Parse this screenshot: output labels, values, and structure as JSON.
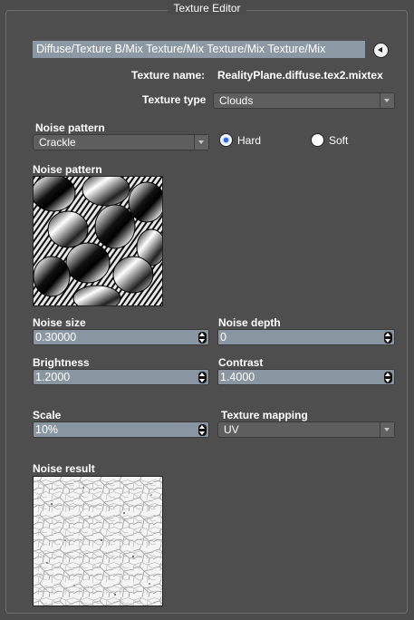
{
  "window": {
    "title": "Texture Editor"
  },
  "path": {
    "value": "Diffuse/Texture B/Mix Texture/Mix Texture/Mix Texture/Mix"
  },
  "texture": {
    "name_label": "Texture name:",
    "name_value": "RealityPlane.diffuse.tex2.mixtex",
    "type_label": "Texture type",
    "type_value": "Clouds"
  },
  "noise_pattern": {
    "label": "Noise pattern",
    "value": "Crackle",
    "preview_label": "Noise pattern"
  },
  "mode": {
    "hard_label": "Hard",
    "soft_label": "Soft",
    "selected": "Hard"
  },
  "fields": {
    "noise_size": {
      "label": "Noise size",
      "value": "0.30000"
    },
    "noise_depth": {
      "label": "Noise depth",
      "value": "0"
    },
    "brightness": {
      "label": "Brightness",
      "value": "1.2000"
    },
    "contrast": {
      "label": "Contrast",
      "value": "1.4000"
    },
    "scale": {
      "label": "Scale",
      "value": "10%"
    }
  },
  "mapping": {
    "label": "Texture mapping",
    "value": "UV"
  },
  "result": {
    "label": "Noise result"
  },
  "icons": {
    "back": "back-arrow-icon",
    "dropdown": "chevron-down-icon",
    "stepper": "stepper-arrows-icon"
  },
  "colors": {
    "background": "#4b4b4b",
    "field": "#8996a1",
    "radio_selected": "#2f6ad9"
  }
}
